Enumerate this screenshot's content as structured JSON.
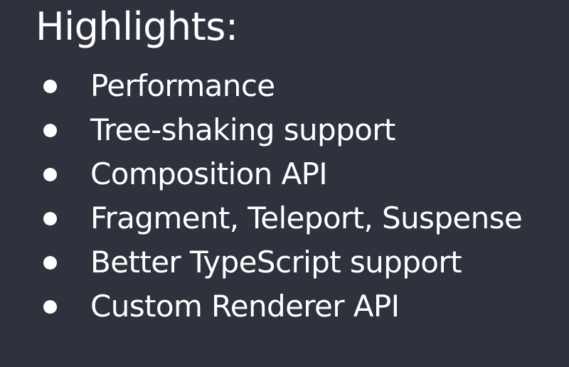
{
  "slide": {
    "title": "Highlights:",
    "bullets": [
      "Performance",
      "Tree-shaking support",
      "Composition API",
      "Fragment, Teleport, Suspense",
      "Better TypeScript support",
      "Custom Renderer API"
    ]
  },
  "colors": {
    "background": "#2f323d",
    "text": "#ffffff"
  }
}
